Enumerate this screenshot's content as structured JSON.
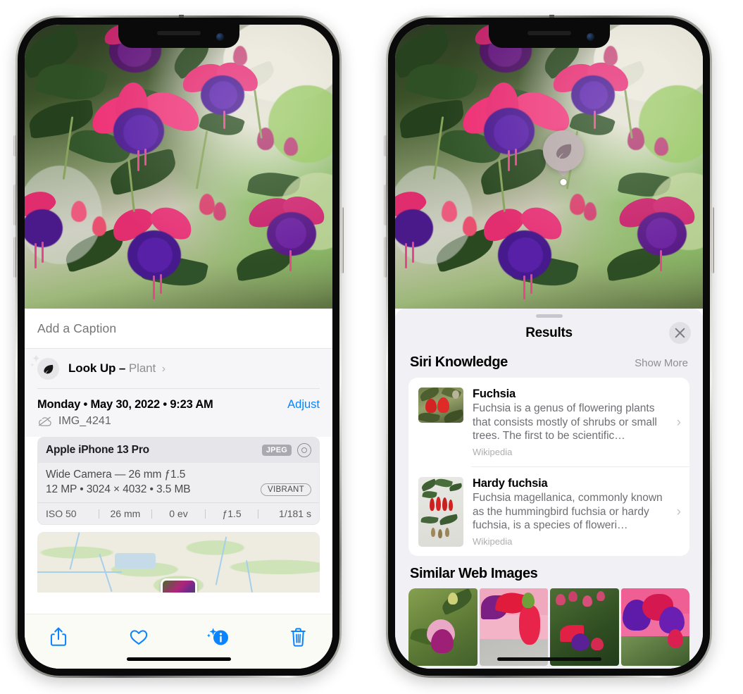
{
  "left_phone": {
    "name": "photos-detail-screen",
    "caption": {
      "placeholder": "Add a Caption",
      "value": ""
    },
    "look_up": {
      "label": "Look Up –",
      "subject": "Plant",
      "chevron": "›",
      "icon": "leaf-icon"
    },
    "meta": {
      "date": "Monday • May 30, 2022 • 9:23 AM",
      "adjust": "Adjust",
      "filename": "IMG_4241",
      "cloud_icon": "cloud-slash-icon"
    },
    "camera_card": {
      "model": "Apple iPhone 13 Pro",
      "format_chip": "JPEG",
      "raw_icon": "raw-circle-icon",
      "lens_line": "Wide Camera — 26 mm ƒ1.5",
      "spec_line": "12 MP • 3024 × 4032 • 3.5 MB",
      "style_chip": "VIBRANT",
      "exif": [
        "ISO 50",
        "26 mm",
        "0 ev",
        "ƒ1.5",
        "1/181 s"
      ]
    },
    "map": {
      "name": "location-map-strip"
    },
    "tab_bar": [
      {
        "name": "share-button",
        "icon": "share-icon"
      },
      {
        "name": "favorite-button",
        "icon": "heart-icon"
      },
      {
        "name": "info-button",
        "icon": "info-sparkle-icon"
      },
      {
        "name": "delete-button",
        "icon": "trash-icon"
      }
    ],
    "accent_color": "#0a84ff"
  },
  "right_phone": {
    "name": "visual-look-up-results-screen",
    "badge": {
      "icon": "leaf-icon",
      "name": "visual-look-up-badge"
    },
    "sheet": {
      "title": "Results",
      "close_icon": "close-icon",
      "siri_knowledge": {
        "heading": "Siri Knowledge",
        "action": "Show More",
        "items": [
          {
            "title": "Fuchsia",
            "description": "Fuchsia is a genus of flowering plants that consists mostly of shrubs or small trees. The first to be scientific…",
            "source": "Wikipedia",
            "thumb": "fuchsia-red-flowers-thumb"
          },
          {
            "title": "Hardy fuchsia",
            "description": "Fuchsia magellanica, commonly known as the hummingbird fuchsia or hardy fuchsia, is a species of floweri…",
            "source": "Wikipedia",
            "thumb": "hardy-fuchsia-specimen-thumb"
          }
        ]
      },
      "similar_web_images": {
        "heading": "Similar Web Images",
        "tiles": [
          "fuchsia-pink-white-bloom",
          "fuchsia-red-bells-closeup",
          "fuchsia-shrub-buds",
          "fuchsia-purple-magenta-cluster"
        ]
      }
    }
  },
  "photo": {
    "name": "fuchsia-flowers-photo",
    "subject": "Fuchsia flowers in hanging basket"
  }
}
